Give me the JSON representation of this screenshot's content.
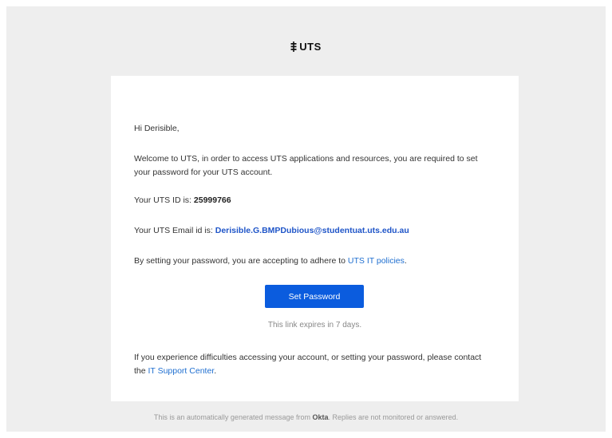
{
  "header": {
    "logo_text": "UTS"
  },
  "email": {
    "greeting": "Hi Derisible,",
    "welcome": "Welcome to UTS, in order to access UTS applications and resources, you are required to set your password for your UTS account.",
    "id_label": "Your UTS ID is: ",
    "id_value": "25999766",
    "email_label": "Your UTS Email id is: ",
    "email_value": "Derisible.G.BMPDubious@studentuat.uts.edu.au",
    "policy_prefix": "By setting your password, you are accepting to adhere to ",
    "policy_link": "UTS IT policies",
    "policy_suffix": ".",
    "button_label": "Set Password",
    "expiry_note": "This link expires in 7 days.",
    "support_prefix": "If you experience difficulties accessing your account, or setting your password, please contact the ",
    "support_link": "IT Support Center",
    "support_suffix": "."
  },
  "footer": {
    "prefix": "This is an automatically generated message from ",
    "brand": "Okta",
    "suffix": ". Replies are not monitored or answered."
  },
  "colors": {
    "background": "#eeeeee",
    "card": "#ffffff",
    "button": "#0b5cde",
    "link": "#1f6fd0"
  }
}
